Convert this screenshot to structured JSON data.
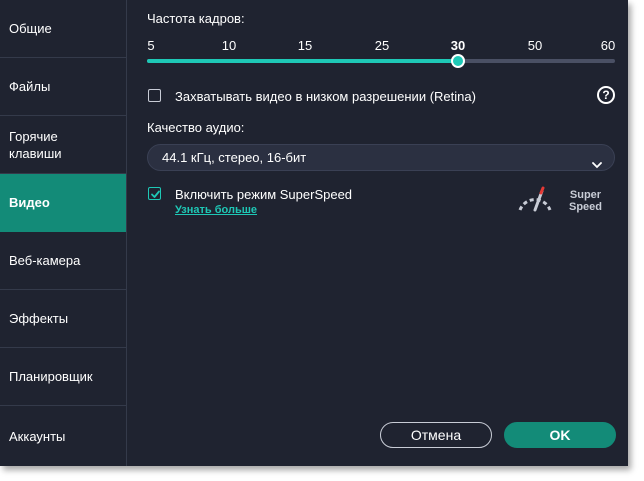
{
  "sidebar": {
    "items": [
      {
        "label": "Общие",
        "active": false
      },
      {
        "label": "Файлы",
        "active": false
      },
      {
        "label": "Горячие клавиши",
        "line1": "Горячие",
        "line2": "клавиши",
        "active": false
      },
      {
        "label": "Видео",
        "active": true
      },
      {
        "label": "Веб-камера",
        "active": false
      },
      {
        "label": "Эффекты",
        "active": false
      },
      {
        "label": "Планировщик",
        "active": false
      },
      {
        "label": "Аккаунты",
        "active": false
      }
    ]
  },
  "video": {
    "framerate_label": "Частота кадров:",
    "framerate_ticks": [
      "5",
      "10",
      "15",
      "25",
      "30",
      "50",
      "60"
    ],
    "framerate_selected": "30",
    "retina_label": "Захватывать видео в низком разрешении (Retina)",
    "retina_checked": false,
    "help_icon": "?",
    "audio_quality_label": "Качество аудио:",
    "audio_quality_value": "44.1 кГц, стерео, 16-бит",
    "superspeed_label": "Включить режим SuperSpeed",
    "superspeed_checked": true,
    "learn_more_link": "Узнать больше",
    "superspeed_badge_line1": "Super",
    "superspeed_badge_line2": "Speed"
  },
  "footer": {
    "cancel_label": "Отмена",
    "ok_label": "OK"
  },
  "colors": {
    "accent": "#138b78",
    "slider": "#1ec8b6",
    "background": "#1f2330"
  }
}
